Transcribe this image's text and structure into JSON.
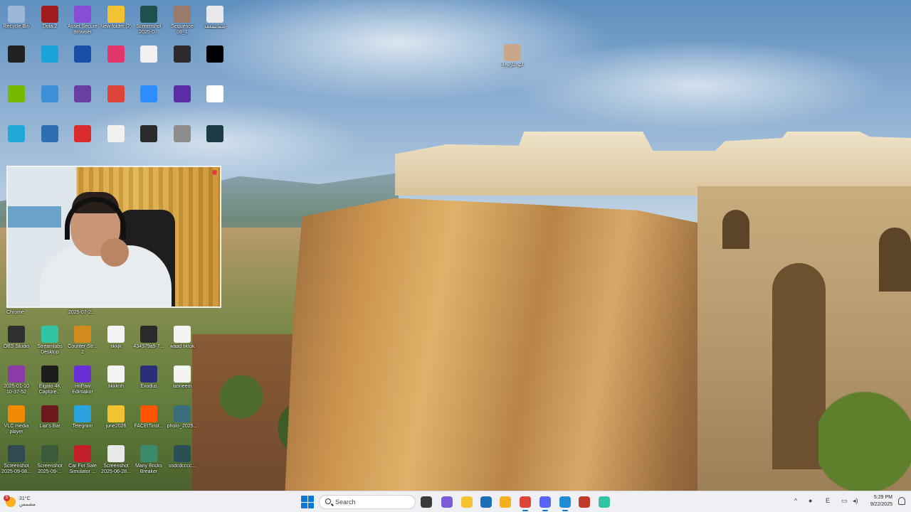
{
  "desktop": {
    "icons": [
      {
        "label": "Recycle Bin",
        "icon": "recycle-bin-icon",
        "color": "#9bb8d6"
      },
      {
        "label": "Dota 2",
        "icon": "dota2-icon",
        "color": "#9e1c1c"
      },
      {
        "label": "Asset Secure Browser",
        "icon": "asset-browser-icon",
        "color": "#8a4bd6"
      },
      {
        "label": "New folder (2)",
        "icon": "folder-icon",
        "color": "#f2c230"
      },
      {
        "label": "Screenshot 2025-0...",
        "icon": "screenshot-icon",
        "color": "#1f4f4f"
      },
      {
        "label": "Sequence 08_1",
        "icon": "sequence-icon",
        "color": "#9a7a6a"
      },
      {
        "label": "عثمانيمعقد",
        "icon": "file-icon",
        "color": "#e9e9ec"
      },
      {
        "label": "",
        "icon": "g-app-icon",
        "color": "#222222"
      },
      {
        "label": "",
        "icon": "edge-icon",
        "color": "#1aa3d8"
      },
      {
        "label": "",
        "icon": "teamviewer-icon",
        "color": "#1b4fa6"
      },
      {
        "label": "",
        "icon": "tiktok-icon",
        "color": "#e0366b"
      },
      {
        "label": "",
        "icon": "document-icon",
        "color": "#f1f1f1"
      },
      {
        "label": "",
        "icon": "image-file-icon",
        "color": "#2b2b2b"
      },
      {
        "label": "",
        "icon": "black-file-icon",
        "color": "#000000"
      },
      {
        "label": "",
        "icon": "nvidia-icon",
        "color": "#76b900"
      },
      {
        "label": "",
        "icon": "network-icon",
        "color": "#3d8fd8"
      },
      {
        "label": "",
        "icon": "winrar-icon",
        "color": "#6a3fa0"
      },
      {
        "label": "",
        "icon": "chrome-icon",
        "color": "#db4437"
      },
      {
        "label": "",
        "icon": "zoom-icon",
        "color": "#2d8cff"
      },
      {
        "label": "",
        "icon": "obs-like-icon",
        "color": "#5b2da6"
      },
      {
        "label": "",
        "icon": "white-file-icon",
        "color": "#ffffff"
      },
      {
        "label": "",
        "icon": "monitor-icon",
        "color": "#22a8d6"
      },
      {
        "label": "",
        "icon": "game-icon",
        "color": "#2d6fb0"
      },
      {
        "label": "",
        "icon": "anydesk-icon",
        "color": "#d92b2b"
      },
      {
        "label": "",
        "icon": "note-icon",
        "color": "#f1f1f1"
      },
      {
        "label": "",
        "icon": "phone-icon",
        "color": "#2a2a2a"
      },
      {
        "label": "",
        "icon": "photo-icon",
        "color": "#8c8c8c"
      },
      {
        "label": "",
        "icon": "dark-file-icon",
        "color": "#1d3b45"
      },
      {
        "label": "OBS Studio",
        "icon": "obs-studio-icon",
        "color": "#302e31"
      },
      {
        "label": "Streamlabs Desktop",
        "icon": "streamlabs-icon",
        "color": "#31c3a2"
      },
      {
        "label": "Counter-Str... 2",
        "icon": "counter-strike-icon",
        "color": "#d28a1c"
      },
      {
        "label": "tikkjk",
        "icon": "file-icon",
        "color": "#f4f4f4"
      },
      {
        "label": "434979a9-7...",
        "icon": "video-file-icon",
        "color": "#2a2a2a"
      },
      {
        "label": "waad tiktok",
        "icon": "text-file-icon",
        "color": "#f4f4f4"
      },
      {
        "label": "2025-01-10 10-37-52",
        "icon": "winrar-archive-icon",
        "color": "#8a3ba6"
      },
      {
        "label": "Elgato 4K Capture...",
        "icon": "elgato-icon",
        "color": "#1c1c1c"
      },
      {
        "label": "HitPaw Edimakor",
        "icon": "hitpaw-icon",
        "color": "#6b2fd6"
      },
      {
        "label": "tikkknh",
        "icon": "file-icon",
        "color": "#f4f4f4"
      },
      {
        "label": "Exodus",
        "icon": "exodus-icon",
        "color": "#2c2e7a"
      },
      {
        "label": "tasneem",
        "icon": "text-file-icon",
        "color": "#f4f4f4"
      },
      {
        "label": "VLC media player",
        "icon": "vlc-icon",
        "color": "#f08a00"
      },
      {
        "label": "Liar's Bar",
        "icon": "liars-bar-icon",
        "color": "#6a1a1a"
      },
      {
        "label": "Telegram",
        "icon": "telegram-icon",
        "color": "#2aa3df"
      },
      {
        "label": "june2026",
        "icon": "folder-icon",
        "color": "#f2c230"
      },
      {
        "label": "FACEITinst...",
        "icon": "faceit-icon",
        "color": "#ff5500"
      },
      {
        "label": "photo_2025...",
        "icon": "photo-icon",
        "color": "#3b6e7a"
      },
      {
        "label": "Screenshot 2025-09-08...",
        "icon": "screenshot-icon",
        "color": "#2f4b4f"
      },
      {
        "label": "Screenshot 2025-09-...",
        "icon": "screenshot-icon",
        "color": "#3a5a3a"
      },
      {
        "label": "Car For Sale Simulator ...",
        "icon": "car-for-sale-icon",
        "color": "#c21f2a"
      },
      {
        "label": "Screenshot 2025-06-28...",
        "icon": "screenshot-icon",
        "color": "#e8e8e8"
      },
      {
        "label": "Many Bricks Breaker",
        "icon": "bricks-breaker-icon",
        "color": "#3b8a6b"
      },
      {
        "label": "ssdcdcccc...",
        "icon": "screenshot-icon",
        "color": "#2a4f55"
      },
      {
        "label": "ابو عازه_4",
        "icon": "portrait-icon",
        "color": "#c9a78a"
      }
    ],
    "below_cam_labels": [
      "Chrome",
      "2025-07-2..."
    ]
  },
  "taskbar": {
    "weather": {
      "temp": "31°C",
      "desc": "مشمس",
      "badge": "5"
    },
    "search_placeholder": "Search",
    "apps": [
      {
        "icon": "task-view-icon",
        "color": "#3a3a3a"
      },
      {
        "icon": "copilot-icon",
        "color": "#7b5bd6"
      },
      {
        "icon": "file-explorer-icon",
        "color": "#f2c230"
      },
      {
        "icon": "store-icon",
        "color": "#1a6fb8"
      },
      {
        "icon": "chrome-canary-icon",
        "color": "#f2b01e"
      },
      {
        "icon": "chrome-icon",
        "color": "#db4437"
      },
      {
        "icon": "discord-icon",
        "color": "#5865f2"
      },
      {
        "icon": "app-window-icon",
        "color": "#1f8bd6"
      },
      {
        "icon": "media-icon",
        "color": "#c0392b"
      },
      {
        "icon": "streamlabs-taskbar-icon",
        "color": "#31c3a2"
      }
    ],
    "tray": {
      "lang": "E",
      "time": "5:29 PM",
      "date": "9/22/2025"
    }
  }
}
